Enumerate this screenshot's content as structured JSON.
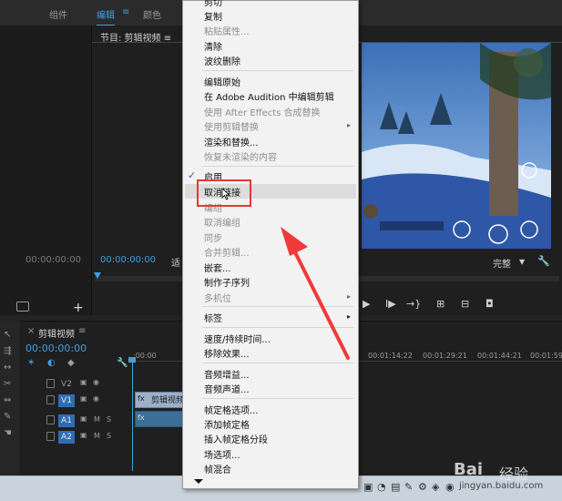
{
  "workspace": {
    "tabs": [
      "组件",
      "编辑",
      "颜色"
    ],
    "active_tab": "编辑",
    "menu_glyph": "≡"
  },
  "source": {
    "timecode": "00:00:00:00",
    "add_glyph": "+"
  },
  "program": {
    "title": "节目: 剪辑视频",
    "menu_glyph": "≡",
    "timecode": "00:00:00:00",
    "fit": "适",
    "quality": "完整",
    "quality_arrow": "▼"
  },
  "transport": {
    "buttons": [
      {
        "name": "play",
        "glyph": "▶"
      },
      {
        "name": "step-forward",
        "glyph": "I▶"
      },
      {
        "name": "go-to-out",
        "glyph": "→}"
      },
      {
        "name": "insert",
        "glyph": "⊞"
      },
      {
        "name": "overwrite",
        "glyph": "⊟"
      },
      {
        "name": "export-frame",
        "glyph": "◘"
      }
    ]
  },
  "timeline": {
    "title": "剪辑视频",
    "close_glyph": "×",
    "menu_glyph": "≡",
    "timecode": "00:00:00:00",
    "ruler": [
      ":00:00",
      "00:01:14:22",
      "00:01:29:21",
      "00:01:44:21",
      "00:01:59:21"
    ],
    "tracks": [
      {
        "name": "V2",
        "targeted": false,
        "kind": "video"
      },
      {
        "name": "V1",
        "targeted": true,
        "kind": "video"
      },
      {
        "name": "A1",
        "targeted": true,
        "kind": "audio"
      },
      {
        "name": "A2",
        "targeted": true,
        "kind": "audio"
      }
    ],
    "track_mute": "M",
    "track_solo": "S",
    "clip_label": "剪辑视频",
    "fx_label": "fx"
  },
  "context_menu": {
    "items": [
      {
        "label": "剪切",
        "disabled": false
      },
      {
        "label": "复制",
        "disabled": false
      },
      {
        "label": "粘贴属性...",
        "disabled": true
      },
      {
        "label": "清除",
        "disabled": false
      },
      {
        "label": "波纹删除",
        "disabled": false
      },
      {
        "label": "编辑原始",
        "disabled": false
      },
      {
        "label": "在 Adobe Audition 中编辑剪辑",
        "disabled": false
      },
      {
        "label": "使用 After Effects 合成替换",
        "disabled": true
      },
      {
        "label": "使用剪辑替换",
        "disabled": true
      },
      {
        "label": "渲染和替换...",
        "disabled": false
      },
      {
        "label": "恢复未渲染的内容",
        "disabled": true
      },
      {
        "label": "启用",
        "disabled": false
      },
      {
        "label": "取消链接",
        "disabled": false
      },
      {
        "label": "编组",
        "disabled": true
      },
      {
        "label": "取消编组",
        "disabled": true
      },
      {
        "label": "同步",
        "disabled": true
      },
      {
        "label": "合并剪辑...",
        "disabled": true
      },
      {
        "label": "嵌套...",
        "disabled": false
      },
      {
        "label": "制作子序列",
        "disabled": false
      },
      {
        "label": "多机位",
        "disabled": true
      },
      {
        "label": "标签",
        "disabled": false
      },
      {
        "label": "速度/持续时间...",
        "disabled": false
      },
      {
        "label": "移除效果...",
        "disabled": false
      },
      {
        "label": "音频增益...",
        "disabled": false
      },
      {
        "label": "音频声道...",
        "disabled": false
      },
      {
        "label": "帧定格选项...",
        "disabled": false
      },
      {
        "label": "添加帧定格",
        "disabled": false
      },
      {
        "label": "插入帧定格分段",
        "disabled": false
      },
      {
        "label": "场选项...",
        "disabled": false
      },
      {
        "label": "帧混合",
        "disabled": false
      }
    ],
    "submenu_glyph": "▸",
    "check_glyph": "✓"
  },
  "watermark": {
    "brand": "Bai",
    "cn": "经验",
    "url": "jingyan.baidu.com"
  },
  "colors": {
    "accent": "#3f9fe0",
    "highlight": "#e53935"
  }
}
